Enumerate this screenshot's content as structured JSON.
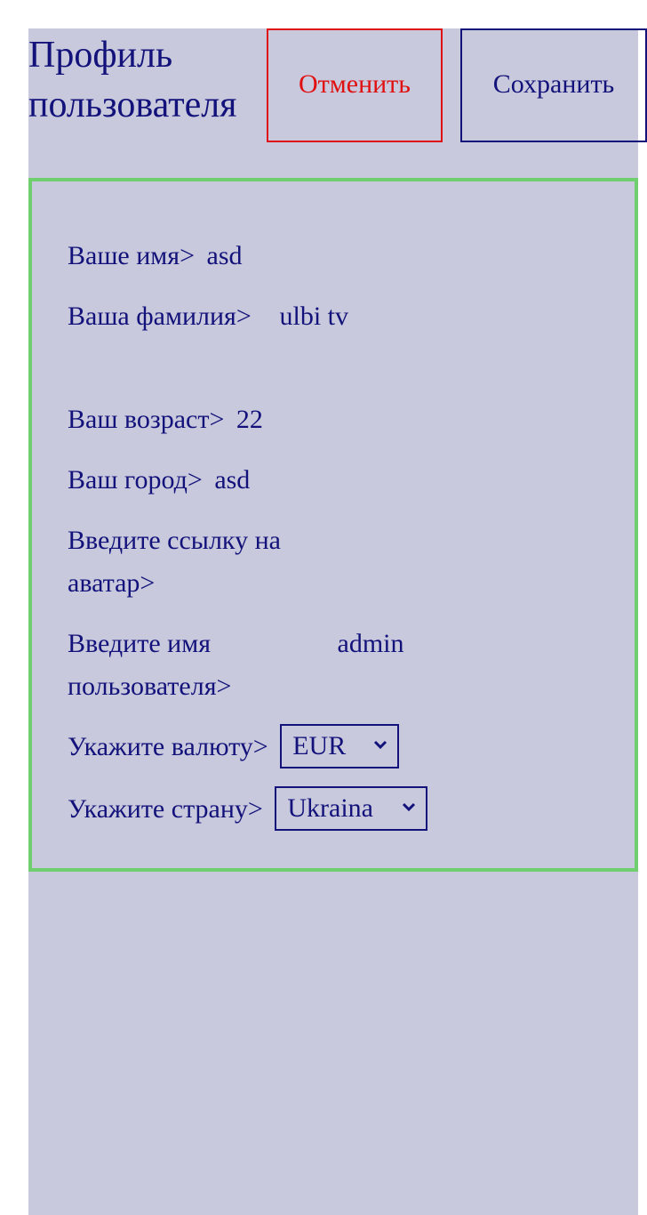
{
  "header": {
    "title": "Профиль пользователя",
    "cancel_label": "Отменить",
    "save_label": "Сохранить"
  },
  "form": {
    "first_name": {
      "label": "Ваше имя>",
      "value": "asd"
    },
    "last_name": {
      "label": "Ваша фамилия>",
      "value": "ulbi tv"
    },
    "age": {
      "label": "Ваш возраст>",
      "value": "22"
    },
    "city": {
      "label": "Ваш город>",
      "value": "asd"
    },
    "avatar": {
      "label": "Введите ссылку на аватар>",
      "value": ""
    },
    "username": {
      "label": "Введите имя пользователя>",
      "value": "admin"
    },
    "currency": {
      "label": "Укажите валюту>",
      "selected": "EUR"
    },
    "country": {
      "label": "Укажите страну>",
      "selected": "Ukraina"
    }
  },
  "colors": {
    "text": "#12127a",
    "background": "#c9c9de",
    "cancel": "#e01010",
    "card_border": "#6fcf6f"
  }
}
